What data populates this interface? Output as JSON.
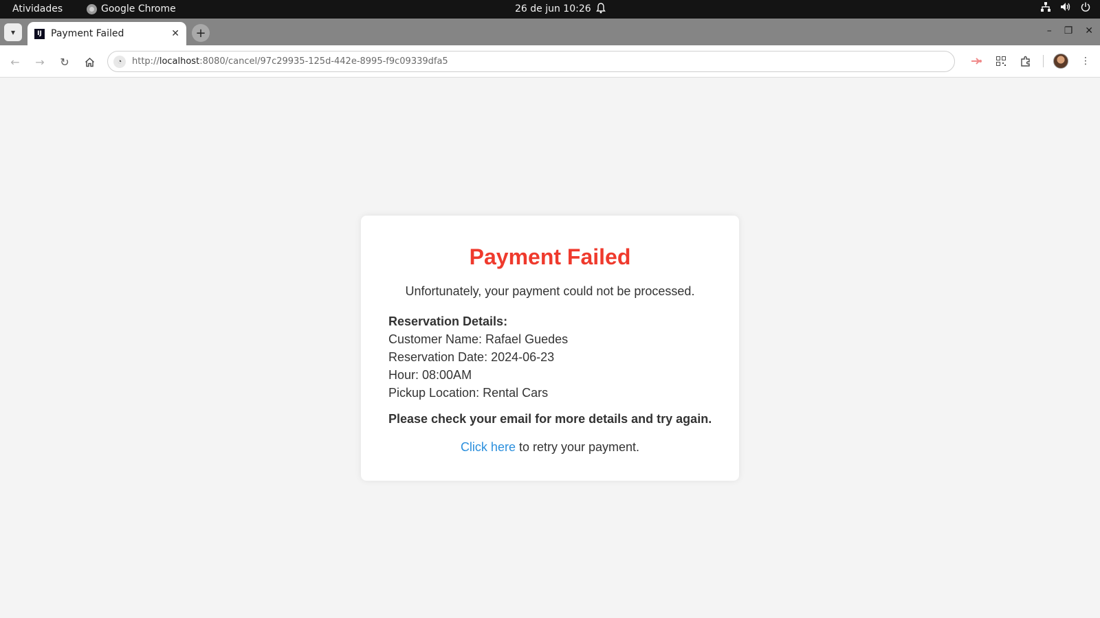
{
  "topbar": {
    "activities": "Atividades",
    "app_name": "Google Chrome",
    "clock": "26 de jun  10:26",
    "tray_icons": [
      "network-icon",
      "volume-icon",
      "power-icon"
    ]
  },
  "browser": {
    "tab_title": "Payment Failed",
    "favicon_text": "IJ",
    "url_prefix": "http://",
    "url_host": "localhost",
    "url_rest": ":8080/cancel/97c29935-125d-442e-8995-f9c09339dfa5"
  },
  "page": {
    "title": "Payment Failed",
    "subtitle": "Unfortunately, your payment could not be processed.",
    "details_heading": "Reservation Details:",
    "customer_name": "Customer Name: Rafael Guedes",
    "reservation_date": "Reservation Date: 2024-06-23",
    "hour": "Hour: 08:00AM",
    "pickup_location": "Pickup Location: Rental Cars",
    "note": "Please check your email for more details and try again.",
    "retry_link": "Click here",
    "retry_text": " to retry your payment."
  },
  "colors": {
    "error_title": "#ef3a2d",
    "link": "#2b8fdd",
    "page_background": "#f4f4f4"
  }
}
